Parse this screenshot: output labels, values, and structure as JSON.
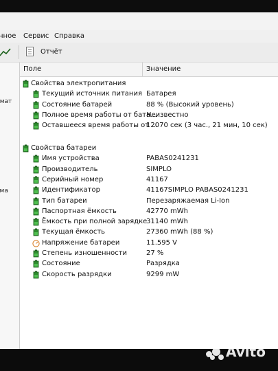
{
  "menu": {
    "partial_left": "нное",
    "service": "Сервис",
    "help": "Справка"
  },
  "toolbar": {
    "report_label": "Отчёт"
  },
  "left_pane": {
    "snippet_1": "рмат",
    "snippet_2": "ема"
  },
  "columns": {
    "field": "Поле",
    "value": "Значение"
  },
  "groups": [
    {
      "title": "Свойства электропитания",
      "rows": [
        {
          "label": "Текущий источник питания",
          "value": "Батарея"
        },
        {
          "label": "Состояние батарей",
          "value": "88 % (Высокий уровень)"
        },
        {
          "label": "Полное время работы от бата...",
          "value": "Неизвестно"
        },
        {
          "label": "Оставшееся время работы от ...",
          "value": "12070 сек (3 час., 21 мин, 10 сек)"
        }
      ]
    },
    {
      "title": "Свойства батареи",
      "rows": [
        {
          "label": "Имя устройства",
          "value": "PABAS0241231"
        },
        {
          "label": "Производитель",
          "value": "SIMPLO"
        },
        {
          "label": "Серийный номер",
          "value": "41167"
        },
        {
          "label": "Идентификатор",
          "value": "41167SIMPLO PABAS0241231"
        },
        {
          "label": "Тип батареи",
          "value": "Перезаряжаемая Li-Ion"
        },
        {
          "label": "Паспортная ёмкость",
          "value": "42770 mWh"
        },
        {
          "label": "Ёмкость при полной зарядке",
          "value": "31140 mWh"
        },
        {
          "label": "Текущая ёмкость",
          "value": "27360 mWh (88 %)"
        },
        {
          "label": "Напряжение батареи",
          "value": "11.595 V"
        },
        {
          "label": "Степень изношенности",
          "value": "27 %"
        },
        {
          "label": "Состояние",
          "value": "Разрядка"
        },
        {
          "label": "Скорость разрядки",
          "value": "9299 mW"
        }
      ]
    }
  ],
  "watermark": "Avito",
  "colors": {
    "battery_icon": "#2e8b2e",
    "gauge_icon": "#d9822b",
    "header_bg": "#f4f4f4"
  }
}
